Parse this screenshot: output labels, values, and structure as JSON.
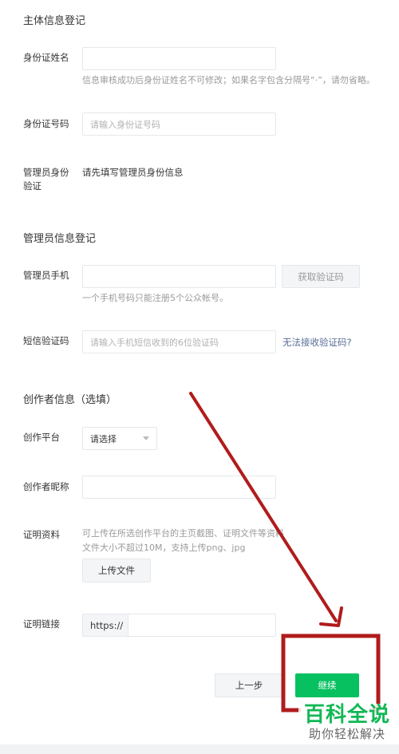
{
  "sections": {
    "subject": "主体信息登记",
    "admin": "管理员信息登记",
    "creator": "创作者信息（选填）"
  },
  "id_name": {
    "label": "身份证姓名",
    "hint": "信息审核成功后身份证姓名不可修改；如果名字包含分隔号“·”，请勿省略。"
  },
  "id_number": {
    "label": "身份证号码",
    "placeholder": "请输入身份证号码"
  },
  "admin_verify": {
    "label_line1": "管理员身份",
    "label_line2": "验证",
    "text": "请先填写管理员身份信息"
  },
  "admin_phone": {
    "label": "管理员手机",
    "get_code_button": "获取验证码",
    "hint": "一个手机号码只能注册5个公众帐号。"
  },
  "sms_code": {
    "label": "短信验证码",
    "placeholder": "请输入手机短信收到的6位验证码",
    "help_link": "无法接收验证码?"
  },
  "creator_platform": {
    "label": "创作平台",
    "selected": "请选择"
  },
  "creator_nickname": {
    "label": "创作者昵称"
  },
  "proof_material": {
    "label": "证明资料",
    "hint_line1": "可上传在所选创作平台的主页截图、证明文件等资料",
    "hint_line2": "文件大小不超过10M，支持上传png、jpg",
    "upload_button": "上传文件"
  },
  "proof_link": {
    "label": "证明链接",
    "prefix": "https://"
  },
  "footer": {
    "prev_button": "上一步",
    "continue_button": "继续"
  },
  "watermark": {
    "main": "百科全说",
    "sub": "助你轻松解决"
  },
  "colors": {
    "accent_green": "#07c160",
    "link_blue": "#576b95",
    "annotation_red": "#b01c1c"
  }
}
